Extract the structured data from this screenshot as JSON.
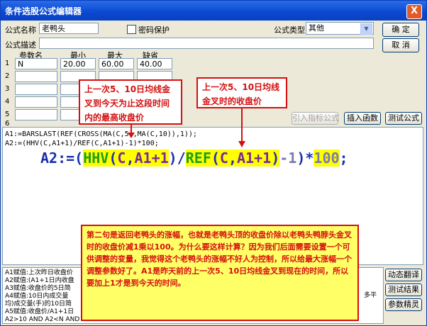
{
  "window": {
    "title": "条件选股公式编辑器",
    "close_glyph": "X"
  },
  "form": {
    "name_label": "公式名称",
    "name_value": "老鸭头",
    "password_label": "密码保护",
    "type_label": "公式类型",
    "type_value": "其他",
    "desc_label": "公式描述",
    "desc_value": ""
  },
  "buttons": {
    "ok": "确 定",
    "cancel": "取 消",
    "import": "引入指标公式",
    "insert_func": "插入函数",
    "test": "测试公式",
    "dynamic_translate": "动态翻译",
    "test_result": "测试结果",
    "param_tune": "参数精灵"
  },
  "params": {
    "headers": [
      "参数名",
      "最小",
      "最大",
      "缺省"
    ],
    "rows": [
      {
        "num": "1",
        "name": "N",
        "min": "20.00",
        "max": "60.00",
        "default": "40.00"
      },
      {
        "num": "2",
        "name": "",
        "min": "",
        "max": "",
        "default": ""
      },
      {
        "num": "3",
        "name": "",
        "min": "",
        "max": "",
        "default": ""
      },
      {
        "num": "4",
        "name": "",
        "min": "",
        "max": "",
        "default": ""
      },
      {
        "num": "5",
        "name": "",
        "min": "",
        "max": "",
        "default": ""
      },
      {
        "num": "6",
        "name": "",
        "min": "",
        "max": "",
        "default": ""
      }
    ]
  },
  "editor": {
    "line1": "A1:=BARSLAST(REF(CROSS(MA(C,5),MA(C,10)),1));",
    "line2": "A2:=(HHV(C,A1+1)/REF(C,A1+1)-1)*100;",
    "big_tokens": [
      "A2:=(",
      "HHV",
      "(",
      "C",
      ",",
      "A1+1",
      ")/",
      "REF",
      "(",
      "C",
      ",",
      "A1+1",
      ")",
      "-1",
      ")*",
      "100",
      ";"
    ]
  },
  "annotations": {
    "left_box": "上一次5、10日均线金叉到今天为止这段时间内的最高收盘价",
    "right_box": "上一次5、10日均线金叉时的收盘价",
    "bottom_box": "第二句是返回老鸭头的涨幅，也就是老鸭头顶的收盘价除以老鸭头鸭脖头金叉时的收盘价减1乘以100。为什么要这样计算？因为我们后面需要设置一个可供调整的变量，我觉得这个老鸭头的涨幅不好人为控制，所以给最大涨幅一个调整参数好了。A1是昨天前的上一次5、10日均线金叉到现在的时间，所以要加上1才是到今天的时间。"
  },
  "status_lines": [
    "A1赋值:上次昨日收盘价",
    "A2赋值:(A1+1日内收盘",
    "A3赋值:收盘价的5日简",
    "A4赋值:10日内成交量",
    "均)成交量(手)的10日简",
    "A5赋值:收盘价/A1+1日",
    "A2>10 AND A2<N AND A"
  ],
  "status_right": "多平",
  "colors": {
    "title_bar": "#0a48d0",
    "annotation_red": "#d41010",
    "highlight_yellow": "#ffff00"
  }
}
